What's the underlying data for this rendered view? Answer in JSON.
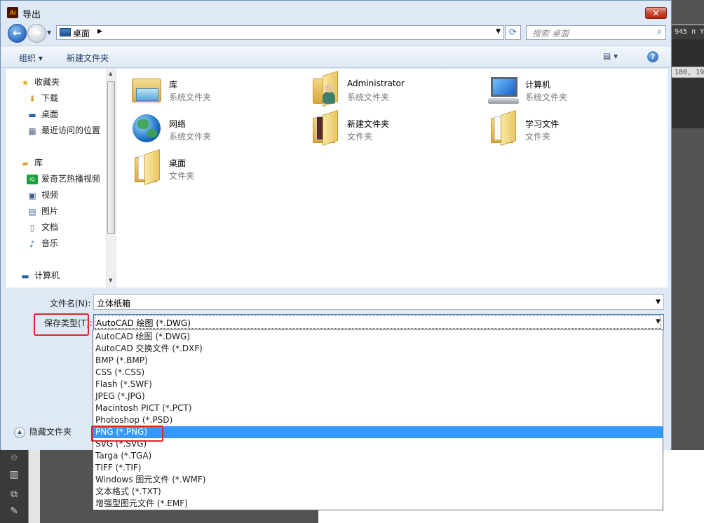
{
  "background_app": {
    "coord_field": "945 п Y",
    "ruler_text": "180, 19"
  },
  "dialog": {
    "title": "导出",
    "app_icon": "Ai",
    "close_label": "✕"
  },
  "address": {
    "location": "桌面",
    "search_placeholder": "搜索 桌面"
  },
  "toolbar": {
    "organize": "组织 ▾",
    "new_folder": "新建文件夹",
    "view": "▤ ▾",
    "help": "?"
  },
  "sidebar": {
    "favorites": "收藏夹",
    "downloads": "下载",
    "desktop": "桌面",
    "recent": "最近访问的位置",
    "libraries": "库",
    "iqiyi": "爱奇艺热播视频",
    "videos": "视频",
    "pictures": "图片",
    "documents": "文档",
    "music": "音乐",
    "computer": "计算机"
  },
  "files": [
    {
      "name": "库",
      "type": "系统文件夹"
    },
    {
      "name": "Administrator",
      "type": "系统文件夹"
    },
    {
      "name": "计算机",
      "type": "系统文件夹"
    },
    {
      "name": "网络",
      "type": "系统文件夹"
    },
    {
      "name": "新建文件夹",
      "type": "文件夹"
    },
    {
      "name": "学习文件",
      "type": "文件夹"
    },
    {
      "name": "桌面",
      "type": "文件夹"
    }
  ],
  "form": {
    "filename_label": "文件名(N):",
    "filename_value": "立体纸箱",
    "savetype_label": "保存类型(T):",
    "savetype_value": "AutoCAD 绘图 (*.DWG)",
    "hide_folders": "隐藏文件夹"
  },
  "savetype_options": [
    "AutoCAD 绘图 (*.DWG)",
    "AutoCAD 交换文件 (*.DXF)",
    "BMP (*.BMP)",
    "CSS (*.CSS)",
    "Flash (*.SWF)",
    "JPEG (*.JPG)",
    "Macintosh PICT (*.PCT)",
    "Photoshop (*.PSD)",
    "PNG (*.PNG)",
    "SVG (*.SVG)",
    "Targa (*.TGA)",
    "TIFF (*.TIF)",
    "Windows 图元文件 (*.WMF)",
    "文本格式 (*.TXT)",
    "增强型图元文件 (*.EMF)"
  ],
  "selected_option_index": 8,
  "colors": {
    "selection": "#3399ff",
    "highlight_box": "#e0262a"
  }
}
